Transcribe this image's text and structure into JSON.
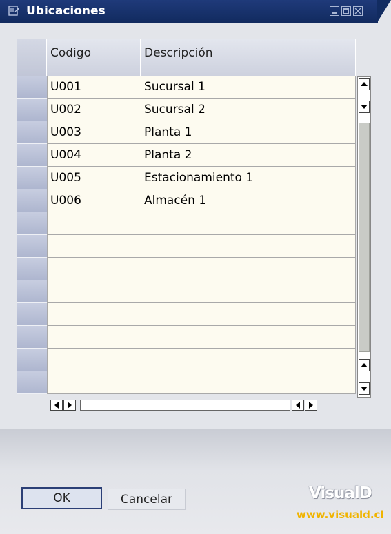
{
  "window": {
    "title": "Ubicaciones",
    "title_icon": "form-icon",
    "controls": [
      "minimize-icon",
      "maximize-icon",
      "close-icon"
    ]
  },
  "grid": {
    "columns": [
      "Codigo",
      "Descripción"
    ],
    "rows": [
      {
        "code": "U001",
        "description": "Sucursal 1"
      },
      {
        "code": "U002",
        "description": "Sucursal 2"
      },
      {
        "code": "U003",
        "description": "Planta 1"
      },
      {
        "code": "U004",
        "description": "Planta 2"
      },
      {
        "code": "U005",
        "description": "Estacionamiento 1"
      },
      {
        "code": "U006",
        "description": "Almacén 1"
      },
      {
        "code": "",
        "description": ""
      },
      {
        "code": "",
        "description": ""
      },
      {
        "code": "",
        "description": ""
      },
      {
        "code": "",
        "description": ""
      },
      {
        "code": "",
        "description": ""
      },
      {
        "code": "",
        "description": ""
      },
      {
        "code": "",
        "description": ""
      },
      {
        "code": "",
        "description": ""
      }
    ]
  },
  "buttons": {
    "ok": "OK",
    "cancel": "Cancelar"
  },
  "branding": {
    "logo": "VisualD",
    "url": "www.visuald.cl"
  },
  "colors": {
    "titlebar": "#1f3a7a",
    "row_background": "#fdfbf0",
    "logo_url": "#f0b400"
  }
}
